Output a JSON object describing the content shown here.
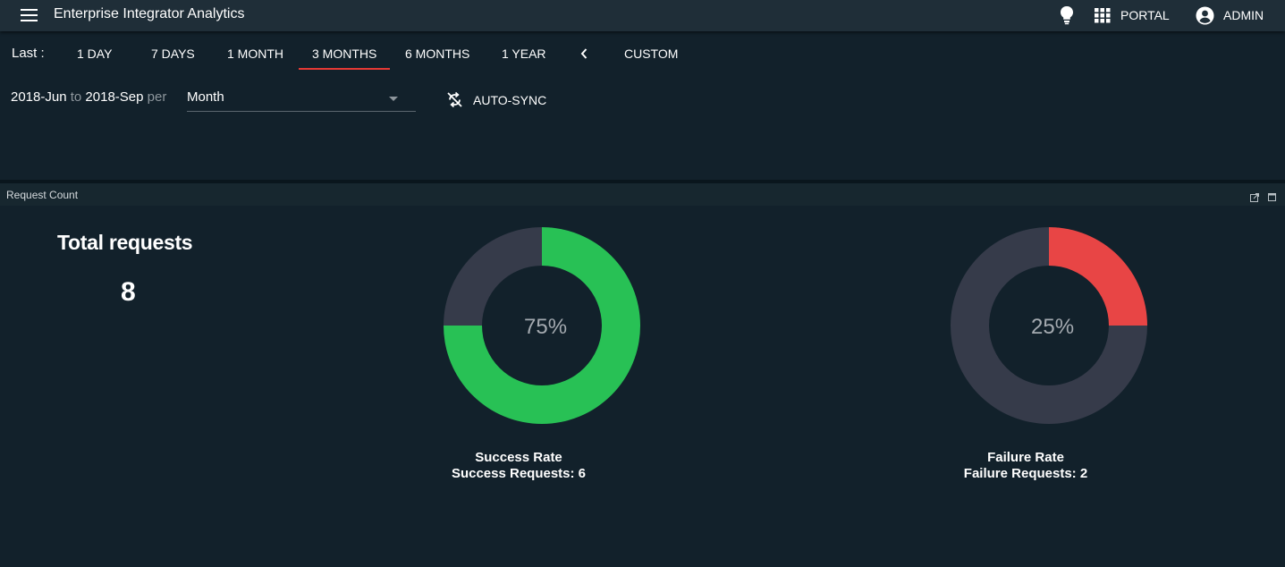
{
  "header": {
    "app_title": "Enterprise Integrator Analytics",
    "portal_label": "PORTAL",
    "admin_label": "ADMIN",
    "icons": [
      "menu-icon",
      "lightbulb-icon",
      "apps-grid-icon",
      "account-icon"
    ]
  },
  "date_range": {
    "last_label": "Last :",
    "options": [
      "1 DAY",
      "7 DAYS",
      "1 MONTH",
      "3 MONTHS",
      "6 MONTHS",
      "1 YEAR"
    ],
    "selected": "3 MONTHS",
    "custom_label": "CUSTOM",
    "accent_color": "#e53935"
  },
  "period": {
    "from": "2018-Jun",
    "to_word": "to",
    "to": "2018-Sep",
    "per_word": "per",
    "granularity": "Month",
    "auto_sync_label": "AUTO-SYNC"
  },
  "panel": {
    "title": "Request Count",
    "total_title": "Total requests",
    "total_value": "8"
  },
  "chart_data": [
    {
      "type": "pie",
      "donut": true,
      "center_label": "75%",
      "caption": "Success Rate",
      "subcaption": "Success Requests: 6",
      "slices": [
        {
          "label": "success",
          "value": 6,
          "color": "#28c155"
        },
        {
          "label": "other",
          "value": 2,
          "color": "#363b4a"
        }
      ]
    },
    {
      "type": "pie",
      "donut": true,
      "center_label": "25%",
      "caption": "Failure Rate",
      "subcaption": "Failure Requests: 2",
      "slices": [
        {
          "label": "failure",
          "value": 2,
          "color": "#e84545"
        },
        {
          "label": "other",
          "value": 6,
          "color": "#363b4a"
        }
      ]
    }
  ]
}
